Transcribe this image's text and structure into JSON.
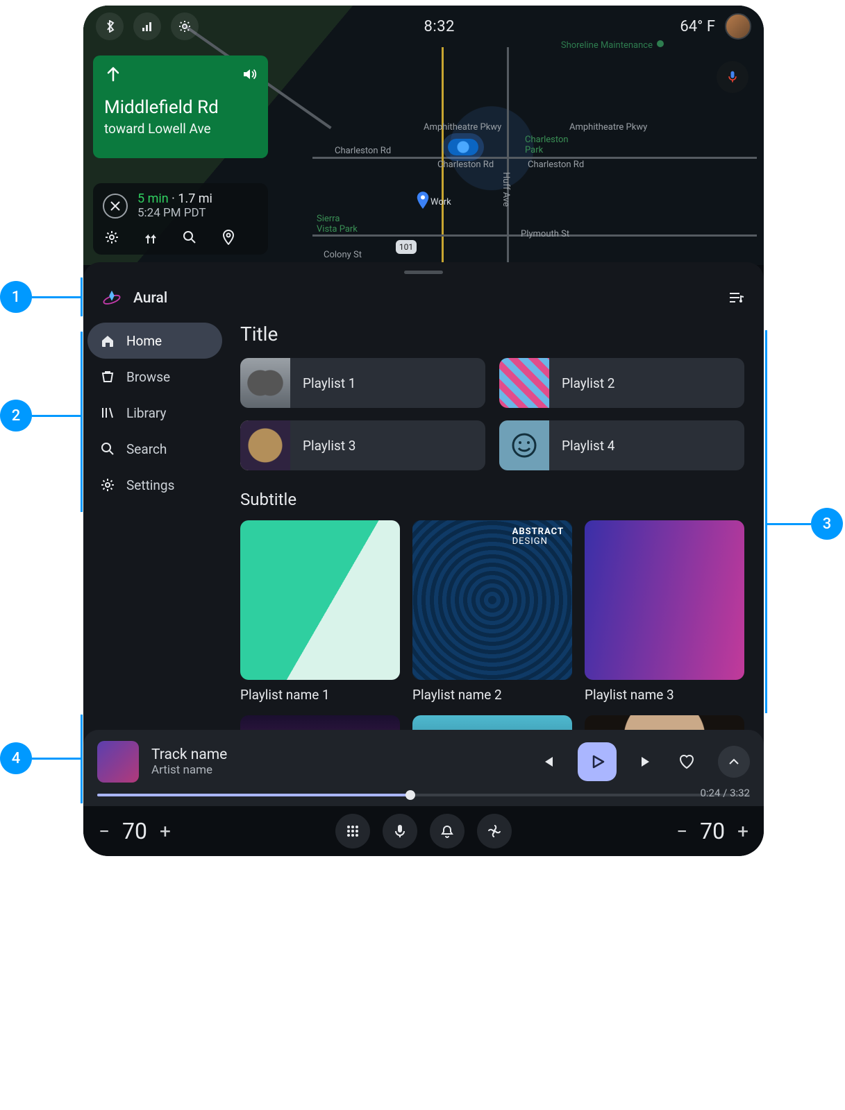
{
  "status": {
    "time": "8:32",
    "temp": "64° F"
  },
  "nav": {
    "street": "Middlefield Rd",
    "toward": "toward Lowell Ave",
    "eta_time": "5 min",
    "eta_sep": " · ",
    "eta_dist": "1.7 mi",
    "arrival": "5:24 PM PDT"
  },
  "map_labels": {
    "shoreline": "Shoreline Maintenance",
    "amp1": "Amphitheatre Pkwy",
    "amp2": "Amphitheatre Pkwy",
    "park": "Charleston\nPark",
    "charleston1": "Charleston Rd",
    "charleston2": "Charleston Rd",
    "charleston3": "Charleston Rd",
    "huff": "Huff Ave",
    "plymouth": "Plymouth St",
    "vista": "Sierra\nVista Park",
    "colony": "Colony St",
    "hwy": "101",
    "work": "Work"
  },
  "app": {
    "name": "Aural"
  },
  "rail": {
    "home": "Home",
    "browse": "Browse",
    "library": "Library",
    "search": "Search",
    "settings": "Settings"
  },
  "section1": {
    "title": "Title",
    "tiles": [
      "Playlist 1",
      "Playlist 2",
      "Playlist 3",
      "Playlist 4"
    ]
  },
  "section2": {
    "title": "Subtitle",
    "cards": [
      "Playlist name 1",
      "Playlist name 2",
      "Playlist name 3"
    ],
    "card2_overlay_top": "ABSTRACT",
    "card2_overlay_bottom": "DESIGN"
  },
  "player": {
    "track": "Track name",
    "artist": "Artist name",
    "elapsed": "0:24",
    "sep": " / ",
    "total": "3:32",
    "progress_pct": 48
  },
  "climate": {
    "left": "70",
    "right": "70"
  },
  "annot": {
    "a1": "1",
    "a2": "2",
    "a3": "3",
    "a4": "4"
  }
}
